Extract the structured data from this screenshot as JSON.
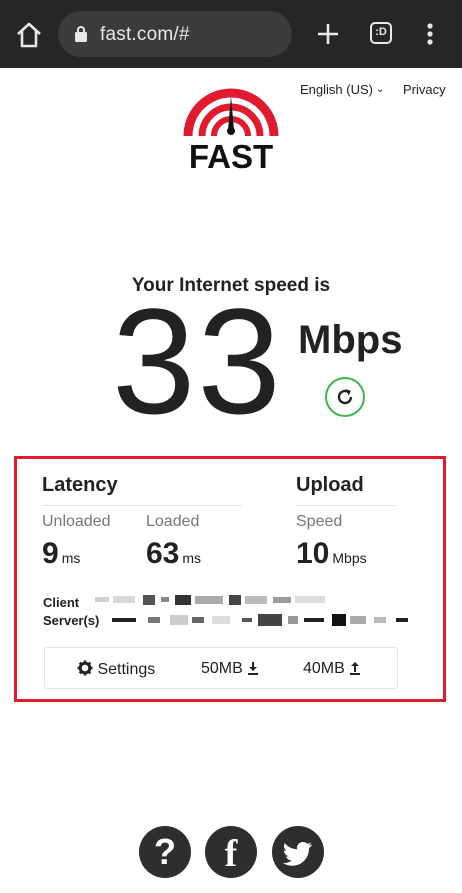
{
  "browser": {
    "url": "fast.com/#",
    "tabs_count": ":D"
  },
  "header": {
    "language": "English (US)",
    "privacy_label": "Privacy",
    "logo_text": "FAST"
  },
  "speed": {
    "heading": "Your Internet speed is",
    "value": "33",
    "unit": "Mbps"
  },
  "details": {
    "latency": {
      "title": "Latency",
      "unloaded_label": "Unloaded",
      "unloaded_value": "9",
      "unloaded_unit": "ms",
      "loaded_label": "Loaded",
      "loaded_value": "63",
      "loaded_unit": "ms"
    },
    "upload": {
      "title": "Upload",
      "speed_label": "Speed",
      "speed_value": "10",
      "speed_unit": "Mbps"
    },
    "client_label": "Client",
    "servers_label": "Server(s)"
  },
  "footer_bar": {
    "settings_label": "Settings",
    "download_size": "50MB",
    "upload_size": "40MB"
  },
  "social": {
    "help_glyph": "?",
    "facebook_glyph": "f"
  },
  "colors": {
    "brand_red": "#e11b2e",
    "refresh_green": "#3bb44a",
    "topbar": "#262626"
  }
}
